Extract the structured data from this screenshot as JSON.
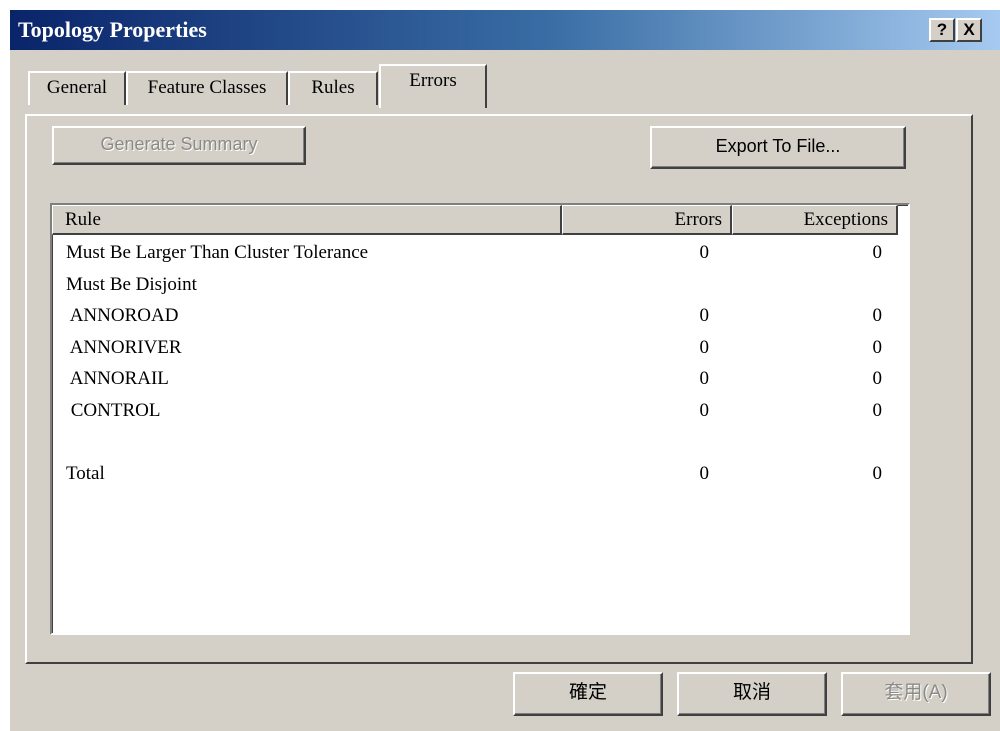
{
  "window": {
    "title": "Topology Properties",
    "help_button": "?",
    "close_button": "X"
  },
  "tabs": [
    {
      "label": "General",
      "active": false
    },
    {
      "label": "Feature Classes",
      "active": false
    },
    {
      "label": "Rules",
      "active": false
    },
    {
      "label": "Errors",
      "active": true
    }
  ],
  "toolbar": {
    "generate_summary_label": "Generate Summary",
    "generate_summary_enabled": false,
    "export_label": "Export To File..."
  },
  "table": {
    "columns": [
      "Rule",
      "Errors",
      "Exceptions"
    ],
    "rows": [
      {
        "rule": "Must Be Larger Than Cluster Tolerance",
        "errors": "0",
        "exceptions": "0"
      },
      {
        "rule": "Must Be Disjoint",
        "errors": "",
        "exceptions": ""
      },
      {
        "rule": " ANNOROAD",
        "errors": "0",
        "exceptions": "0"
      },
      {
        "rule": " ANNORIVER",
        "errors": "0",
        "exceptions": "0"
      },
      {
        "rule": " ANNORAIL",
        "errors": "0",
        "exceptions": "0"
      },
      {
        "rule": " CONTROL",
        "errors": "0",
        "exceptions": "0"
      },
      {
        "rule": "",
        "errors": "",
        "exceptions": ""
      },
      {
        "rule": "Total",
        "errors": "0",
        "exceptions": "0"
      }
    ]
  },
  "footer": {
    "ok_label": "確定",
    "cancel_label": "取消",
    "apply_label": "套用(A)",
    "apply_enabled": false
  }
}
